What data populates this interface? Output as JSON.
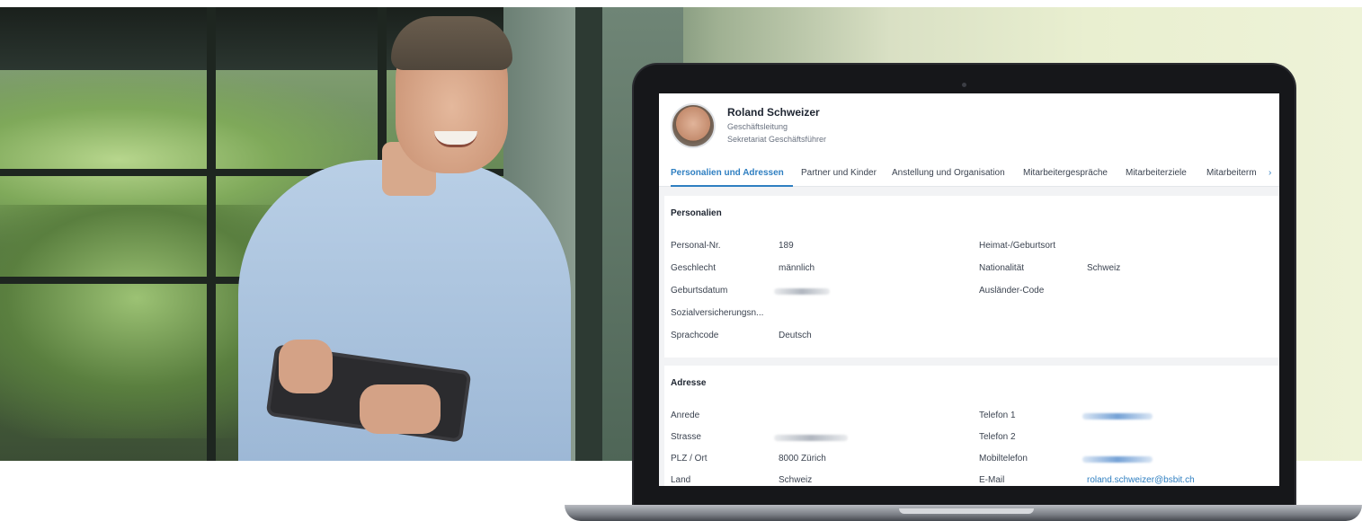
{
  "profile": {
    "name": "Roland Schweizer",
    "role1": "Geschäftsleitung",
    "role2": "Sekretariat Geschäftsführer"
  },
  "tabs": [
    {
      "label": "Personalien und Adressen",
      "active": true
    },
    {
      "label": "Partner und Kinder"
    },
    {
      "label": "Anstellung und Organisation"
    },
    {
      "label": "Mitarbeitergespräche"
    },
    {
      "label": "Mitarbeiterziele"
    },
    {
      "label": "Mitarbeiterm"
    }
  ],
  "tabs_next_icon": "chevron-right-icon",
  "personalien": {
    "title": "Personalien",
    "fields": {
      "personal_nr": {
        "label": "Personal-Nr.",
        "value": "189"
      },
      "geschlecht": {
        "label": "Geschlecht",
        "value": "männlich"
      },
      "geburtsdatum": {
        "label": "Geburtsdatum",
        "value": "",
        "redacted": true
      },
      "sozialversicherung": {
        "label": "Sozialversicherungsn...",
        "value": ""
      },
      "sprachcode": {
        "label": "Sprachcode",
        "value": "Deutsch"
      },
      "heimat": {
        "label": "Heimat-/Geburtsort",
        "value": ""
      },
      "nationalitaet": {
        "label": "Nationalität",
        "value": "Schweiz"
      },
      "auslaender": {
        "label": "Ausländer-Code",
        "value": ""
      }
    }
  },
  "adresse": {
    "title": "Adresse",
    "fields": {
      "anrede": {
        "label": "Anrede",
        "value": ""
      },
      "strasse": {
        "label": "Strasse",
        "value": "",
        "redacted": true
      },
      "plz_ort": {
        "label": "PLZ / Ort",
        "value": "8000 Zürich"
      },
      "land": {
        "label": "Land",
        "value": "Schweiz"
      },
      "telefon1": {
        "label": "Telefon 1",
        "value": "",
        "redacted": true
      },
      "telefon2": {
        "label": "Telefon 2",
        "value": ""
      },
      "mobil": {
        "label": "Mobiltelefon",
        "value": "",
        "redacted": true
      },
      "email": {
        "label": "E-Mail",
        "value": "roland.schweizer@bsbit.ch"
      }
    }
  },
  "colors": {
    "accent": "#2f7fc1",
    "text": "#3b4350",
    "screen_bg": "#f2f3f5",
    "laptop": "#16171a"
  }
}
